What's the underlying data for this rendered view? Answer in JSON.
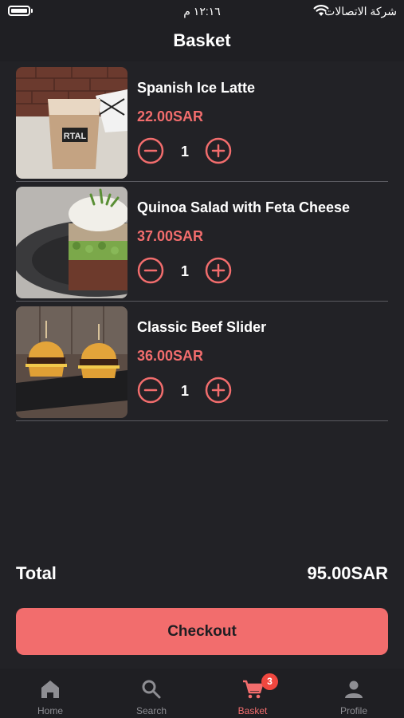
{
  "status_bar": {
    "time": "١٢:١٦ م",
    "carrier": "شركة الاتصالات"
  },
  "header": {
    "title": "Basket"
  },
  "items": [
    {
      "name": "Spanish Ice Latte",
      "price": "22.00SAR",
      "quantity": "1",
      "cup_print": "RTAL"
    },
    {
      "name": "Quinoa Salad with Feta Cheese",
      "price": "37.00SAR",
      "quantity": "1"
    },
    {
      "name": "Classic Beef Slider",
      "price": "36.00SAR",
      "quantity": "1"
    }
  ],
  "summary": {
    "total_label": "Total",
    "total_value": "95.00SAR"
  },
  "checkout": {
    "label": "Checkout"
  },
  "tabs": [
    {
      "label": "Home",
      "icon": "home-icon"
    },
    {
      "label": "Search",
      "icon": "search-icon"
    },
    {
      "label": "Basket",
      "icon": "cart-icon",
      "badge": "3",
      "active": true
    },
    {
      "label": "Profile",
      "icon": "profile-icon"
    }
  ],
  "colors": {
    "accent": "#f26d6d",
    "background": "#222226",
    "bar": "#1f1f23",
    "badge": "#f0473f",
    "inactive": "#8e8e93"
  }
}
